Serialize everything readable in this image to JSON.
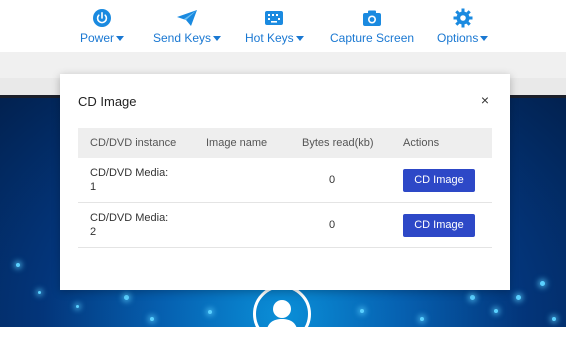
{
  "toolbar": {
    "items": [
      {
        "label": "Power",
        "icon": "power-icon",
        "dropdown": true
      },
      {
        "label": "Send Keys",
        "icon": "send-icon",
        "dropdown": true
      },
      {
        "label": "Hot Keys",
        "icon": "keyboard-icon",
        "dropdown": true
      },
      {
        "label": "Capture Screen",
        "icon": "camera-icon",
        "dropdown": false
      },
      {
        "label": "Options",
        "icon": "gear-icon",
        "dropdown": true
      }
    ],
    "accent_color": "#1a78d2"
  },
  "modal": {
    "title": "CD Image",
    "close_label": "×",
    "columns": [
      "CD/DVD instance",
      "Image name",
      "Bytes read(kb)",
      "Actions"
    ],
    "rows": [
      {
        "instance_line1": "CD/DVD Media:",
        "instance_line2": "1",
        "image_name": "",
        "bytes_read": "0",
        "action_label": "CD Image"
      },
      {
        "instance_line1": "CD/DVD Media:",
        "instance_line2": "2",
        "image_name": "",
        "bytes_read": "0",
        "action_label": "CD Image"
      }
    ],
    "button_color": "#2d48c7"
  },
  "screen": {
    "icon": "user-avatar-icon"
  }
}
